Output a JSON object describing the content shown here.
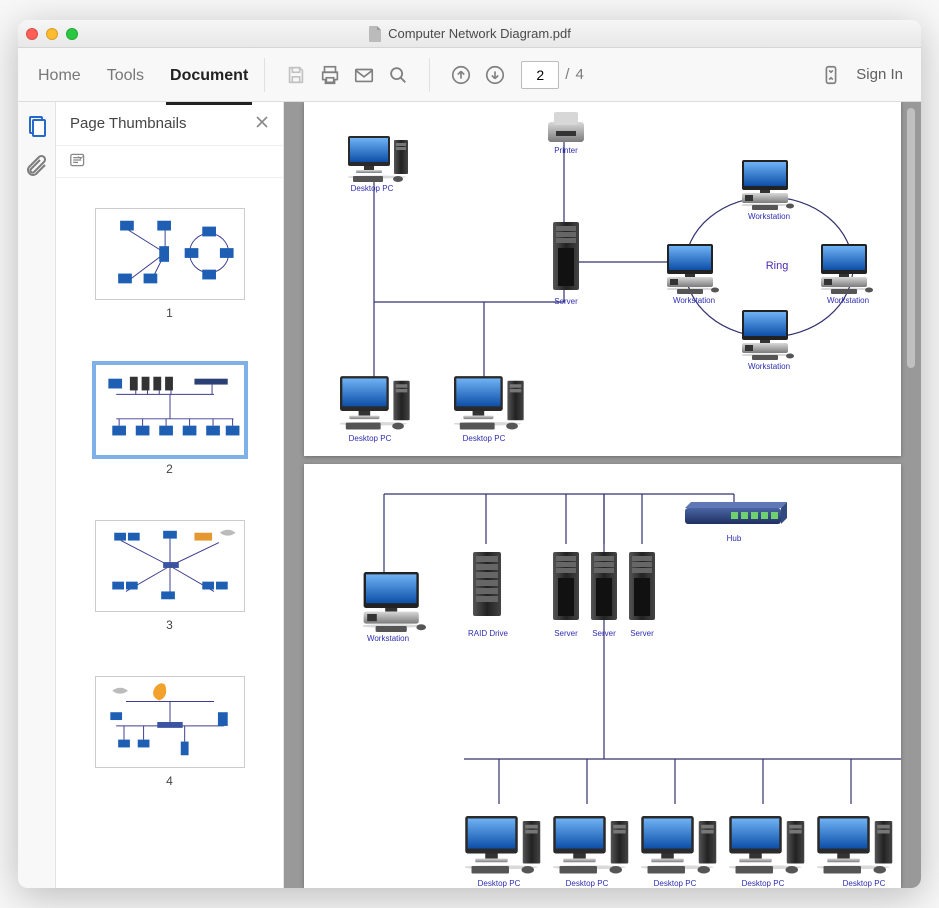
{
  "title": "Computer Network Diagram.pdf",
  "tabs": {
    "home": "Home",
    "tools": "Tools",
    "document": "Document"
  },
  "page": {
    "current": "2",
    "sep": "/",
    "total": "4"
  },
  "signIn": "Sign In",
  "panel": {
    "title": "Page Thumbnails"
  },
  "thumbs": {
    "p1": "1",
    "p2": "2",
    "p3": "3",
    "p4": "4"
  },
  "doc1": {
    "desktop1": "Desktop PC",
    "printer": "Printer",
    "server": "Server",
    "desktop2": "Desktop PC",
    "desktop3": "Desktop PC",
    "ws_top": "Workstation",
    "ws_left": "Workstation",
    "ws_right": "Workstation",
    "ws_bottom": "Workstation",
    "ring": "Ring"
  },
  "doc2": {
    "workstation": "Workstation",
    "raid": "RAID Drive",
    "server1": "Server",
    "server2": "Server",
    "server3": "Server",
    "hub": "Hub",
    "pc1": "Desktop PC",
    "pc2": "Desktop PC",
    "pc3": "Desktop PC",
    "pc4": "Desktop PC",
    "pc5": "Desktop PC"
  }
}
